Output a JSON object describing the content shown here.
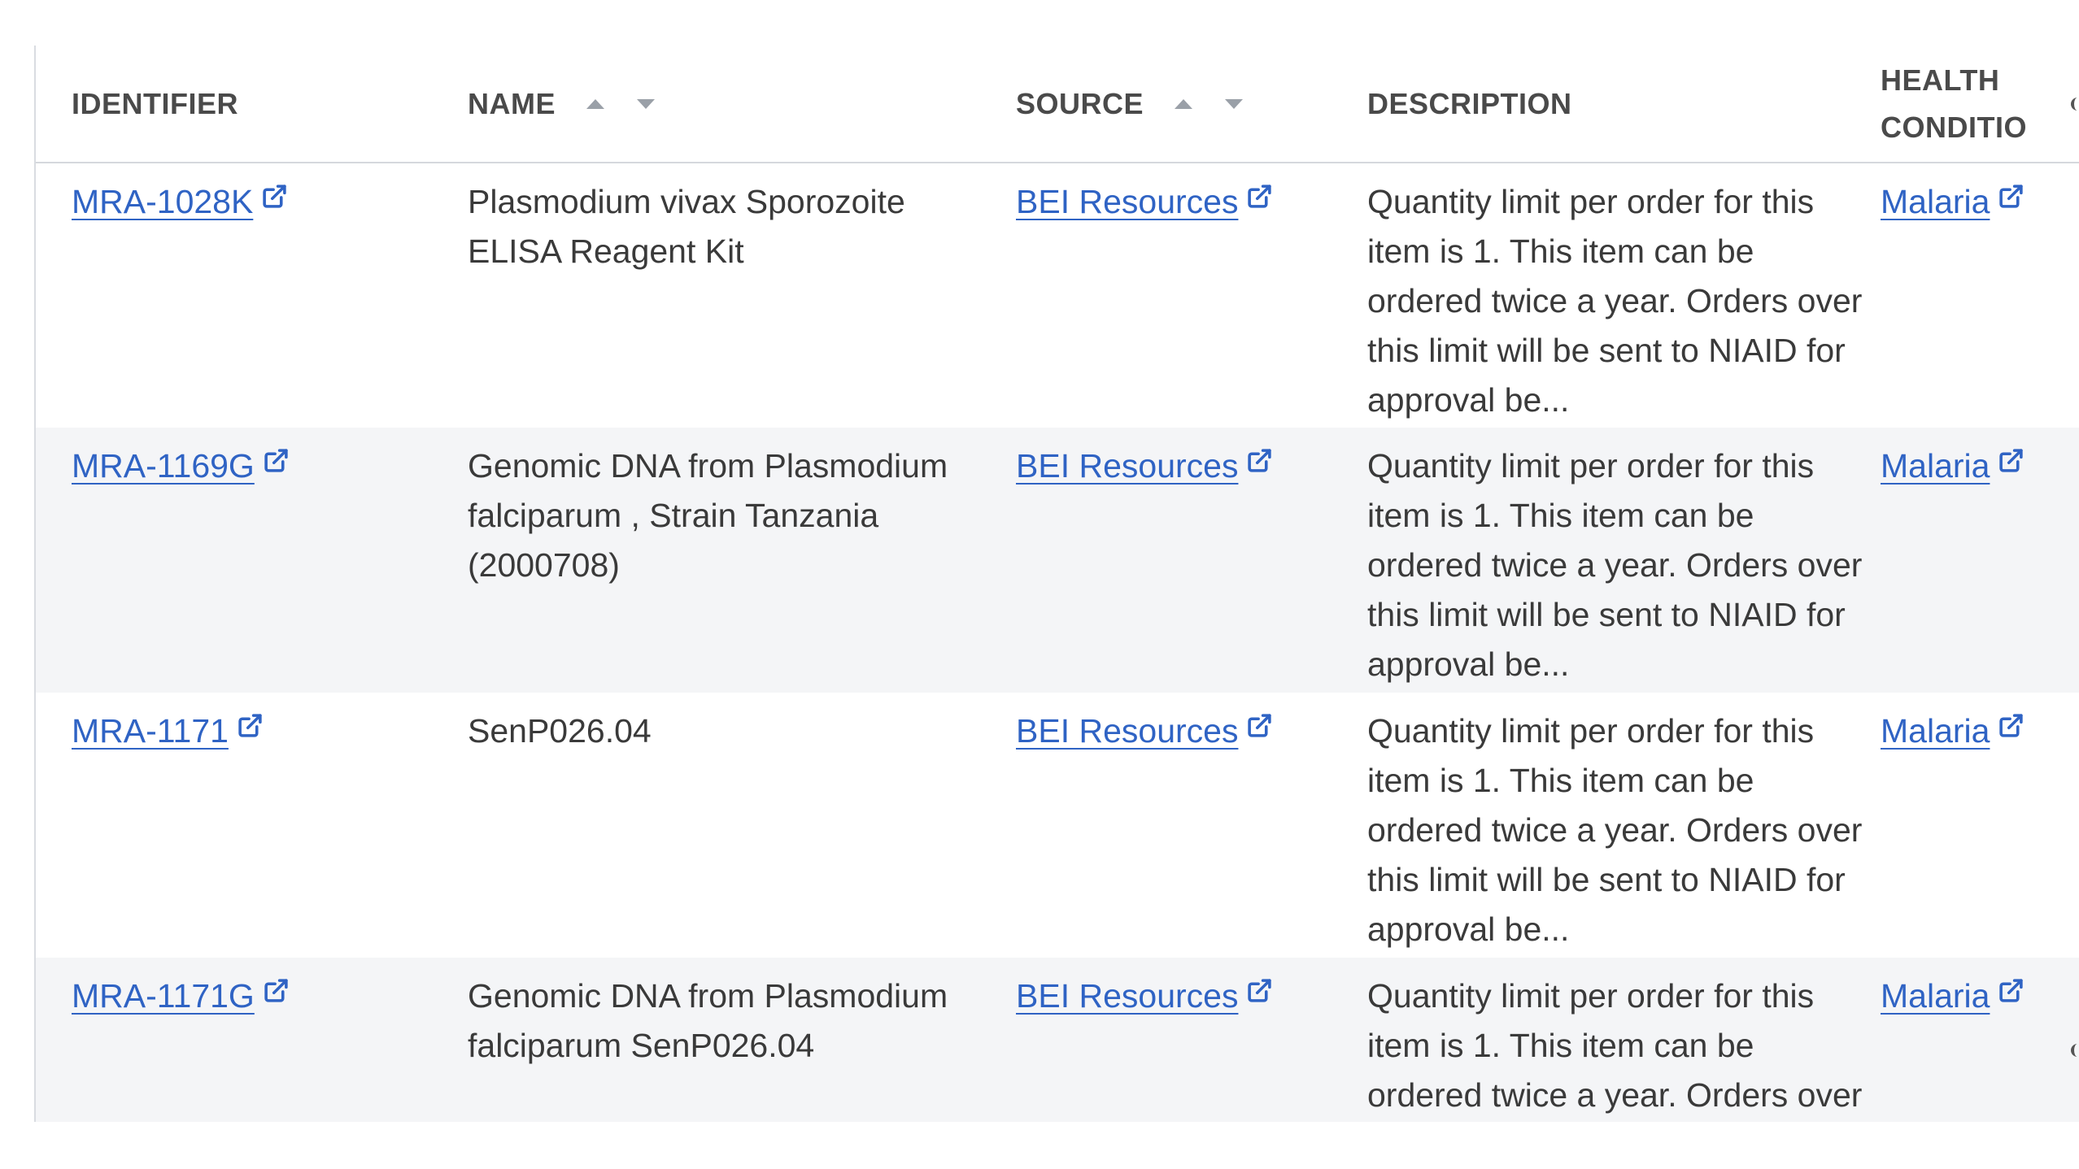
{
  "table": {
    "headers": {
      "identifier": "IDENTIFIER",
      "name": "NAME",
      "source": "SOURCE",
      "description": "DESCRIPTION",
      "health_line1": "HEALTH",
      "health_line2": "CONDITIO"
    },
    "rows": [
      {
        "identifier": "MRA-1028K",
        "name": "Plasmodium vivax Sporozoite ELISA Reagent Kit",
        "source": "BEI Resources",
        "description": "Quantity limit per order for this item is 1. This item can be ordered twice a year. Orders over this limit will be sent to NIAID for approval be...",
        "health": "Malaria"
      },
      {
        "identifier": "MRA-1169G",
        "name": "Genomic DNA from Plasmodium falciparum , Strain Tanzania (2000708)",
        "source": "BEI Resources",
        "description": "Quantity limit per order for this item is 1. This item can be ordered twice a year. Orders over this limit will be sent to NIAID for approval be...",
        "health": "Malaria"
      },
      {
        "identifier": "MRA-1171",
        "name": "SenP026.04",
        "source": "BEI Resources",
        "description": "Quantity limit per order for this item is 1. This item can be ordered twice a year. Orders over this limit will be sent to NIAID for approval be...",
        "health": "Malaria"
      },
      {
        "identifier": "MRA-1171G",
        "name": "Genomic DNA from Plasmodium falciparum SenP026.04",
        "source": "BEI Resources",
        "description": "Quantity limit per order for this item is 1. This item can be ordered twice a year. Orders over this limit will be sent to NIAID for approval be...",
        "health": "Malaria"
      }
    ]
  },
  "colors": {
    "link": "#2f63c4",
    "alt_row": "#f4f5f7",
    "header_text": "#4a4a4a",
    "sort_arrow": "#9aa0a8"
  },
  "icons": {
    "external_link": "external-link-icon",
    "sort_ascending": "sort-ascending-icon",
    "sort_descending": "sort-descending-icon"
  }
}
